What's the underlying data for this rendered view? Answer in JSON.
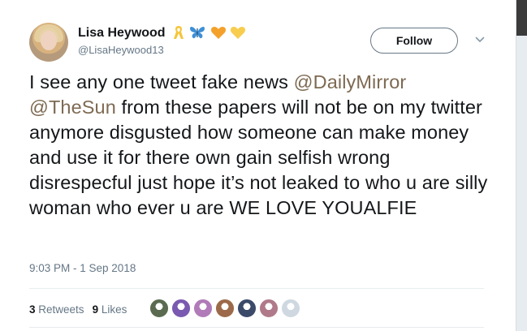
{
  "tweet": {
    "author": {
      "display_name": "Lisa Heywood",
      "handle": "@LisaHeywood13",
      "name_emojis": [
        "yellow-ribbon-icon",
        "butterfly-icon",
        "orange-heart-icon",
        "yellow-heart-icon"
      ]
    },
    "follow_label": "Follow",
    "text_parts": {
      "p1": "I see any one tweet fake news ",
      "m1": "@DailyMirror",
      "p2": " ",
      "m2": "@TheSun",
      "p3": " from these papers will not be on my twitter anymore disgusted how someone can make money and use it for there own gain selfish wrong disrespecful just hope it’s not leaked to who u are silly woman who ever u are  WE LOVE YOUALFIE"
    },
    "timestamp": "9:03 PM - 1 Sep 2018",
    "stats": {
      "retweets_count": "3",
      "retweets_label": "Retweets",
      "likes_count": "9",
      "likes_label": "Likes"
    },
    "liker_colors": [
      "#5a6b4f",
      "#7a5ab0",
      "#b07bb8",
      "#9c6a4a",
      "#3c4a6a",
      "#b07a8a",
      "#cfd8e0"
    ]
  },
  "colors": {
    "mention": "#7e6a52",
    "secondary_text": "#657786",
    "primary_text": "#14171a"
  }
}
